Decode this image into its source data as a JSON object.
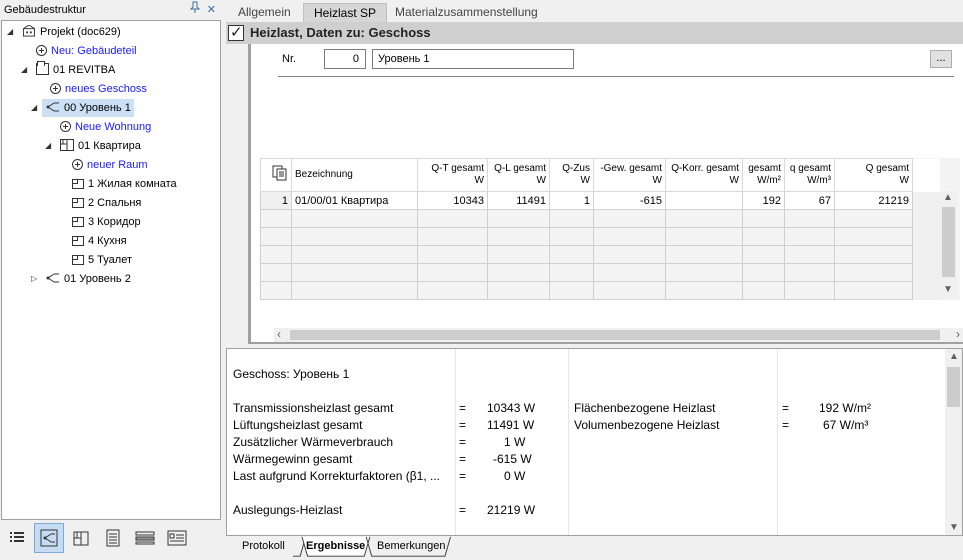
{
  "left_panel": {
    "title": "Gebäudestruktur",
    "pin_icon": "pin-icon",
    "close_icon": "close-icon",
    "tree": [
      {
        "id": "project",
        "label": "Projekt (doc629)",
        "icon": "project-icon",
        "expander": "▲",
        "link": false
      },
      {
        "id": "new-building-part",
        "label": "Neu: Gebäudeteil",
        "icon": "add-icon",
        "expander": "",
        "link": true
      },
      {
        "id": "revitba",
        "label": "01 REVITBA",
        "icon": "building-icon",
        "expander": "▲",
        "link": false
      },
      {
        "id": "new-floor",
        "label": "neues Geschoss",
        "icon": "add-icon",
        "expander": "",
        "link": true
      },
      {
        "id": "level-00",
        "label": "00 Уровень 1",
        "icon": "level-icon",
        "expander": "▲",
        "link": false,
        "selected": true
      },
      {
        "id": "new-apartment",
        "label": "Neue Wohnung",
        "icon": "add-icon",
        "expander": "",
        "link": true
      },
      {
        "id": "apartment",
        "label": "01 Квартира",
        "icon": "apartment-icon",
        "expander": "▲",
        "link": false
      },
      {
        "id": "new-room",
        "label": "neuer Raum",
        "icon": "add-icon",
        "expander": "",
        "link": true
      },
      {
        "id": "room-1",
        "label": "1 Жилая комната",
        "icon": "room-icon",
        "expander": "",
        "link": false
      },
      {
        "id": "room-2",
        "label": "2 Спальня",
        "icon": "room-icon",
        "expander": "",
        "link": false
      },
      {
        "id": "room-3",
        "label": "3 Коридор",
        "icon": "room-icon",
        "expander": "",
        "link": false
      },
      {
        "id": "room-4",
        "label": "4 Кухня",
        "icon": "room-icon",
        "expander": "",
        "link": false
      },
      {
        "id": "room-5",
        "label": "5 Туалет",
        "icon": "room-icon",
        "expander": "",
        "link": false
      },
      {
        "id": "level-01",
        "label": "01 Уровень 2",
        "icon": "level-icon",
        "expander": "▷",
        "link": false
      }
    ],
    "toolbar": [
      "list-view-icon",
      "structure-view-icon",
      "floor-plan-icon",
      "document-icon",
      "layers-icon",
      "properties-icon"
    ]
  },
  "tabs": [
    "Allgemein",
    "Heizlast SP",
    "Materialzusammenstellung"
  ],
  "active_tab": "Heizlast SP",
  "header": {
    "title": "Heizlast, Daten zu: Geschoss",
    "checked": "✓"
  },
  "form": {
    "nr_label": "Nr.",
    "nr_value": "0",
    "name_value": "Уровень 1",
    "dots_label": "..."
  },
  "grid": {
    "columns": [
      {
        "l1": "",
        "l2": ""
      },
      {
        "l1": "Bezeichnung",
        "l2": ""
      },
      {
        "l1": "Q-T gesamt",
        "l2": "W"
      },
      {
        "l1": "Q-L gesamt",
        "l2": "W"
      },
      {
        "l1": "Q-Zus",
        "l2": "W"
      },
      {
        "l1": "-Gew. gesamt",
        "l2": "W"
      },
      {
        "l1": "Q-Korr. gesamt",
        "l2": "W"
      },
      {
        "l1": "gesamt",
        "l2": "W/m²"
      },
      {
        "l1": "q gesamt",
        "l2": "W/m³"
      },
      {
        "l1": "Q gesamt",
        "l2": "W"
      }
    ],
    "rows": [
      [
        "1",
        "01/00/01 Квартира",
        "10343",
        "11491",
        "1",
        "-615",
        "",
        "192",
        "67",
        "21219"
      ]
    ],
    "empty_rows": 6
  },
  "results": {
    "floor_line": "Geschoss: Уровень 1",
    "left": [
      {
        "label": "Transmissionsheizlast gesamt",
        "eq": "=",
        "value": "10343 W"
      },
      {
        "label": "Lüftungsheizlast gesamt",
        "eq": "=",
        "value": "11491 W"
      },
      {
        "label": "Zusätzlicher Wärmeverbrauch",
        "eq": "=",
        "value": "1 W"
      },
      {
        "label": "Wärmegewinn gesamt",
        "eq": "=",
        "value": "-615 W"
      },
      {
        "label": "Last aufgrund Korrekturfaktoren (β1, ...",
        "eq": "=",
        "value": "0 W"
      }
    ],
    "design_label": "Auslegungs-Heizlast",
    "design_eq": "=",
    "design_value": "21219 W",
    "right": [
      {
        "label": "Flächenbezogene Heizlast",
        "eq": "=",
        "value": "192 W/m²"
      },
      {
        "label": "Volumenbezogene Heizlast",
        "eq": "=",
        "value": "67 W/m³"
      }
    ]
  },
  "bottom_tabs": [
    "Protokoll",
    "Ergebnisse",
    "Bemerkungen"
  ],
  "active_bottom_tab": "Ergebnisse"
}
